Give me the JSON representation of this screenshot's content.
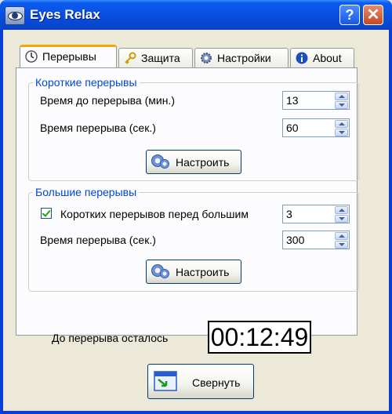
{
  "window": {
    "title": "Eyes Relax",
    "help_label": "?",
    "close_label": "✕"
  },
  "tabs": [
    {
      "label": "Перерывы",
      "icon": "clock-icon",
      "active": true
    },
    {
      "label": "Защита",
      "icon": "key-icon",
      "active": false
    },
    {
      "label": "Настройки",
      "icon": "gear-icon",
      "active": false
    },
    {
      "label": "About",
      "icon": "info-icon",
      "active": false
    }
  ],
  "short_breaks": {
    "title": "Короткие перерывы",
    "time_until_label": "Время до перерыва (мин.)",
    "time_until_value": "13",
    "duration_label": "Время перерыва (сек.)",
    "duration_value": "60",
    "configure_label": "Настроить"
  },
  "long_breaks": {
    "title": "Большие перерывы",
    "count_label": "Коротких перерывов перед большим",
    "count_checked": true,
    "count_value": "3",
    "duration_label": "Время перерыва (сек.)",
    "duration_value": "300",
    "configure_label": "Настроить"
  },
  "status": {
    "remaining_label": "До перерыва осталось",
    "timer_value": "00:12:49"
  },
  "minimize_button": {
    "label": "Свернуть"
  },
  "colors": {
    "title_bar": "#0a4fe0",
    "group_title": "#0046d5",
    "active_tab_accent": "#f7a800"
  }
}
